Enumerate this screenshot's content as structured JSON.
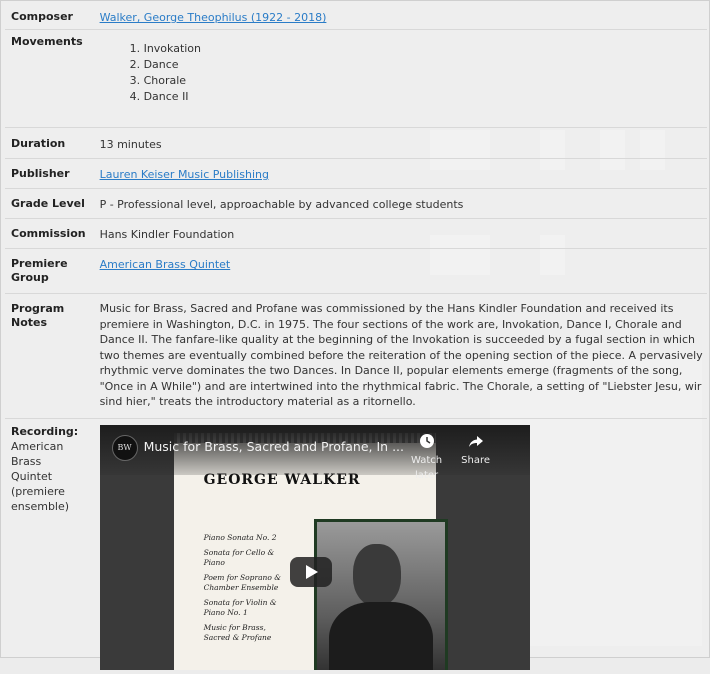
{
  "details": {
    "composer": {
      "label": "Composer",
      "value": "Walker, George Theophilus (1922 - 2018)"
    },
    "movements": {
      "label": "Movements",
      "items": [
        "1. Invokation",
        "2. Dance",
        "3. Chorale",
        "4. Dance II"
      ]
    },
    "duration": {
      "label": "Duration",
      "value": "13 minutes"
    },
    "publisher": {
      "label": "Publisher",
      "value": "Lauren Keiser Music Publishing"
    },
    "grade_level": {
      "label": "Grade Level",
      "value": "P - Professional level, approachable by advanced college students"
    },
    "commission": {
      "label": "Commission",
      "value": "Hans Kindler Foundation"
    },
    "premiere_group": {
      "label": "Premiere Group",
      "value": "American Brass Quintet"
    },
    "program_notes": {
      "label": "Program Notes",
      "value": "Music for Brass, Sacred and Profane was commissioned by the Hans Kindler Foundation and received its premiere in Washington, D.C. in 1975. The four sections of the work are, Invokation, Dance I, Chorale and Dance II. The fanfare-like quality at the beginning of the Invokation is succeeded by a fugal section in which two themes are eventually combined before the reiteration of the opening section of the piece. A pervasively rhythmic verve dominates the two Dances. In Dance II, popular elements emerge (fragments of the song, \"Once in A While\") and are intertwined into the rhythmical fabric. The Chorale, a setting of \"Liebster Jesu, wir sind hier,\" treats the introductory material as a ritornello."
    },
    "recording": {
      "label": "Recording:",
      "detail": "American Brass Quintet (premiere ensemble)"
    }
  },
  "video": {
    "title": "Music for Brass, Sacred and Profane, In ...",
    "watch_later": "Watch later",
    "share": "Share",
    "avatar_text": "BW",
    "cover": {
      "composer_name": "GEORGE WALKER",
      "works": [
        "Piano Sonata No. 2",
        "Sonata for Cello & Piano",
        "Poem for Soprano & Chamber Ensemble",
        "Sonata for Violin & Piano No. 1",
        "Music for Brass, Sacred & Profane"
      ]
    }
  },
  "colors": {
    "link": "#2a7cc7",
    "background": "#ececec"
  }
}
